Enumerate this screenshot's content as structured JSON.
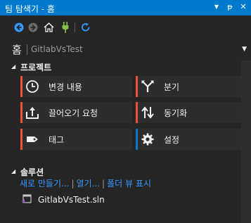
{
  "titlebar": {
    "title": "팀 탐색기 - 홈",
    "controls": [
      "dropdown-arrow",
      "pin",
      "close"
    ],
    "glyphs": {
      "dropdown": "▼",
      "pin": "ᵽ",
      "close": "✕"
    }
  },
  "toolbar": {
    "buttons": [
      "back",
      "forward",
      "home",
      "connect",
      "refresh"
    ]
  },
  "header": {
    "page": "홈",
    "repo": "GitlabVsTest",
    "dropdown_glyph": "▼"
  },
  "project": {
    "title": "프로젝트",
    "items": [
      {
        "label": "변경 내용",
        "icon": "clock-icon",
        "color": "#f05033"
      },
      {
        "label": "분기",
        "icon": "branch-icon",
        "color": "#f05033"
      },
      {
        "label": "끌어오기 요청",
        "icon": "pull-request-icon",
        "color": "#f05033"
      },
      {
        "label": "동기화",
        "icon": "sync-icon",
        "color": "#f05033"
      },
      {
        "label": "태그",
        "icon": "tag-icon",
        "color": "#f05033"
      },
      {
        "label": "설정",
        "icon": "gear-icon",
        "color": "#007acc"
      }
    ]
  },
  "solution": {
    "title": "솔루션",
    "links": [
      "새로 만들기...",
      "열기...",
      "폴더 뷰 표시"
    ],
    "separator": "|",
    "file": "GitlabVsTest.sln"
  },
  "section_glyph": "◢"
}
